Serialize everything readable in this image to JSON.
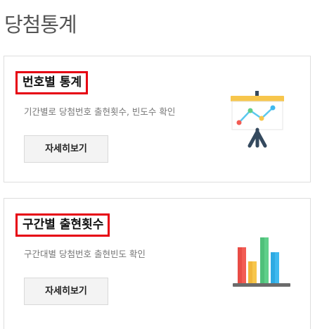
{
  "page": {
    "title": "당첨통계"
  },
  "cards": [
    {
      "title": "번호별 통계",
      "description": "기간별로 당첨번호 출현횟수, 빈도수 확인",
      "button_label": "자세히보기",
      "icon": "presentation-chart-icon"
    },
    {
      "title": "구간별 출현횟수",
      "description": "구간대별 당첨번호 출현빈도 확인",
      "button_label": "자세히보기",
      "icon": "bar-chart-icon"
    }
  ],
  "colors": {
    "highlight_border": "#e60012",
    "board_top": "#f7c64c",
    "stand": "#34495e",
    "line": "#5bc8ee",
    "bar_red": "#f25c54",
    "bar_yellow": "#f7c64c",
    "bar_green": "#5fcf8a",
    "bar_blue": "#3fb9ef"
  }
}
